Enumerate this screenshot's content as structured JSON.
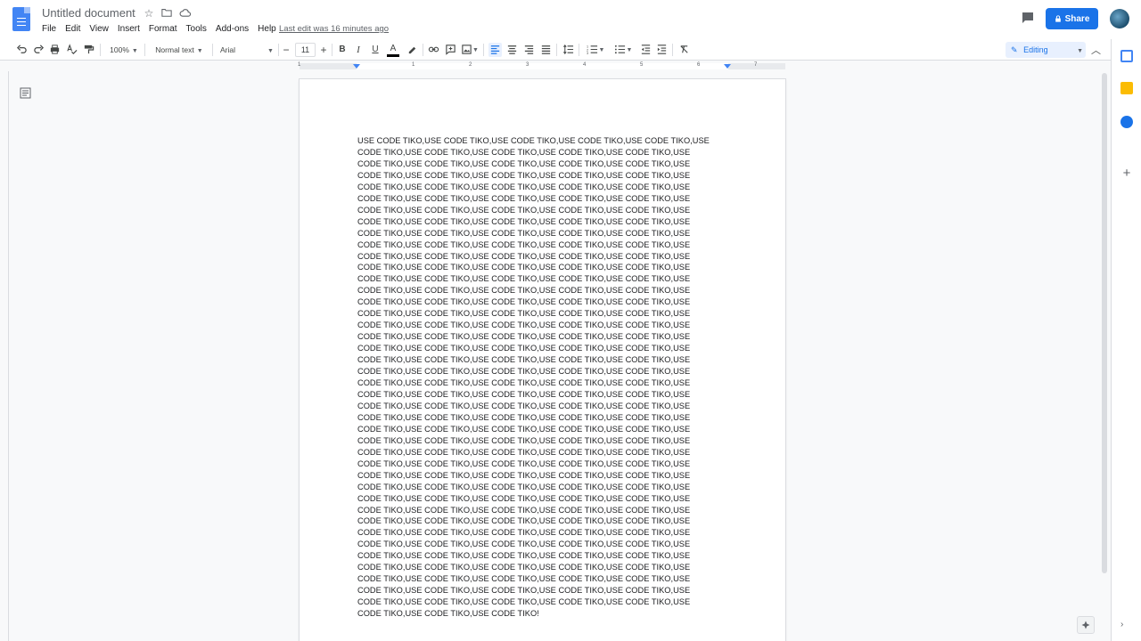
{
  "app": {
    "doc_title": "Untitled document",
    "last_edit": "Last edit was 16 minutes ago",
    "share_label": "Share"
  },
  "menu": [
    "File",
    "Edit",
    "View",
    "Insert",
    "Format",
    "Tools",
    "Add-ons",
    "Help"
  ],
  "toolbar": {
    "zoom": "100%",
    "style": "Normal text",
    "font": "Arial",
    "font_size": "11",
    "bold": "B",
    "italic": "I",
    "underline": "U",
    "text_color": "A",
    "mode": "Editing"
  },
  "ruler": {
    "numbers": [
      "1",
      "1",
      "2",
      "3",
      "4",
      "5",
      "6",
      "7"
    ]
  },
  "document": {
    "body": "USE CODE TIKO,USE CODE TIKO,USE CODE TIKO,USE CODE TIKO,USE CODE TIKO,USE CODE TIKO,USE CODE TIKO,USE CODE TIKO,USE CODE TIKO,USE CODE TIKO,USE CODE TIKO,USE CODE TIKO,USE CODE TIKO,USE CODE TIKO,USE CODE TIKO,USE CODE TIKO,USE CODE TIKO,USE CODE TIKO,USE CODE TIKO,USE CODE TIKO,USE CODE TIKO,USE CODE TIKO,USE CODE TIKO,USE CODE TIKO,USE CODE TIKO,USE CODE TIKO,USE CODE TIKO,USE CODE TIKO,USE CODE TIKO,USE CODE TIKO,USE CODE TIKO,USE CODE TIKO,USE CODE TIKO,USE CODE TIKO,USE CODE TIKO,USE CODE TIKO,USE CODE TIKO,USE CODE TIKO,USE CODE TIKO,USE CODE TIKO,USE CODE TIKO,USE CODE TIKO,USE CODE TIKO,USE CODE TIKO,USE CODE TIKO,USE CODE TIKO,USE CODE TIKO,USE CODE TIKO,USE CODE TIKO,USE CODE TIKO,USE CODE TIKO,USE CODE TIKO,USE CODE TIKO,USE CODE TIKO,USE CODE TIKO,USE CODE TIKO,USE CODE TIKO,USE CODE TIKO,USE CODE TIKO,USE CODE TIKO,USE CODE TIKO,USE CODE TIKO,USE CODE TIKO,USE CODE TIKO,USE CODE TIKO,USE CODE TIKO,USE CODE TIKO,USE CODE TIKO,USE CODE TIKO,USE CODE TIKO,USE CODE TIKO,USE CODE TIKO,USE CODE TIKO,USE CODE TIKO,USE CODE TIKO,USE CODE TIKO,USE CODE TIKO,USE CODE TIKO,USE CODE TIKO,USE CODE TIKO,USE CODE TIKO,USE CODE TIKO,USE CODE TIKO,USE CODE TIKO,USE CODE TIKO,USE CODE TIKO,USE CODE TIKO,USE CODE TIKO,USE CODE TIKO,USE CODE TIKO,USE CODE TIKO,USE CODE TIKO,USE CODE TIKO,USE CODE TIKO,USE CODE TIKO,USE CODE TIKO,USE CODE TIKO,USE CODE TIKO,USE CODE TIKO,USE CODE TIKO,USE CODE TIKO,USE CODE TIKO,USE CODE TIKO,USE CODE TIKO,USE CODE TIKO,USE CODE TIKO,USE CODE TIKO,USE CODE TIKO,USE CODE TIKO,USE CODE TIKO,USE CODE TIKO,USE CODE TIKO,USE CODE TIKO,USE CODE TIKO,USE CODE TIKO,USE CODE TIKO,USE CODE TIKO,USE CODE TIKO,USE CODE TIKO,USE CODE TIKO,USE CODE TIKO,USE CODE TIKO,USE CODE TIKO,USE CODE TIKO,USE CODE TIKO,USE CODE TIKO,USE CODE TIKO,USE CODE TIKO,USE CODE TIKO,USE CODE TIKO,USE CODE TIKO,USE CODE TIKO,USE CODE TIKO,USE CODE TIKO,USE CODE TIKO,USE CODE TIKO,USE CODE TIKO,USE CODE TIKO,USE CODE TIKO,USE CODE TIKO,USE CODE TIKO,USE CODE TIKO,USE CODE TIKO,USE CODE TIKO,USE CODE TIKO,USE CODE TIKO,USE CODE TIKO,USE CODE TIKO,USE CODE TIKO,USE CODE TIKO,USE CODE TIKO,USE CODE TIKO,USE CODE TIKO,USE CODE TIKO,USE CODE TIKO,USE CODE TIKO,USE CODE TIKO,USE CODE TIKO,USE CODE TIKO,USE CODE TIKO,USE CODE TIKO,USE CODE TIKO,USE CODE TIKO,USE CODE TIKO,USE CODE TIKO,USE CODE TIKO,USE CODE TIKO,USE CODE TIKO,USE CODE TIKO,USE CODE TIKO,USE CODE TIKO,USE CODE TIKO,USE CODE TIKO,USE CODE TIKO,USE CODE TIKO,USE CODE TIKO,USE CODE TIKO,USE CODE TIKO,USE CODE TIKO,USE CODE TIKO,USE CODE TIKO,USE CODE TIKO,USE CODE TIKO,USE CODE TIKO,USE CODE TIKO,USE CODE TIKO,USE CODE TIKO,USE CODE TIKO,USE CODE TIKO,USE CODE TIKO,USE CODE TIKO,USE CODE TIKO,USE CODE TIKO,USE CODE TIKO,USE CODE TIKO,USE CODE TIKO,USE CODE TIKO,USE CODE TIKO,USE CODE TIKO,USE CODE TIKO,USE CODE TIKO,USE CODE TIKO,USE CODE TIKO,USE CODE TIKO,USE CODE TIKO,USE CODE TIKO,USE CODE TIKO,USE CODE TIKO!"
  },
  "icons": {
    "undo": "undo-icon",
    "redo": "redo-icon",
    "print": "print-icon",
    "spellcheck": "spellcheck-icon",
    "paint_format": "paint-format-icon",
    "link": "link-icon",
    "comment": "comment-icon",
    "image": "image-icon",
    "align_left": "align-left-icon",
    "align_center": "align-center-icon",
    "align_right": "align-right-icon",
    "justify": "justify-icon",
    "line_spacing": "line-spacing-icon",
    "numbered_list": "numbered-list-icon",
    "bulleted_list": "bulleted-list-icon",
    "decrease_indent": "decrease-indent-icon",
    "increase_indent": "increase-indent-icon",
    "clear_format": "clear-formatting-icon"
  },
  "colors": {
    "accent": "#1a73e8",
    "doc_blue": "#4285f4",
    "keep_yellow": "#fbbc04",
    "tasks_blue": "#1a73e8",
    "calendar_blue": "#4285f4"
  }
}
